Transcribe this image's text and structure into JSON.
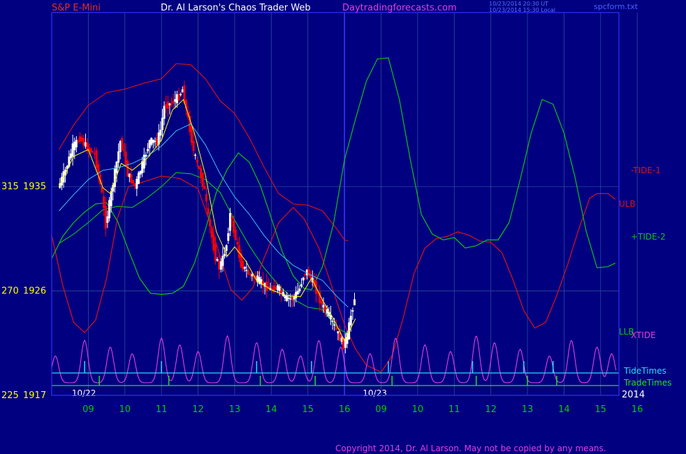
{
  "header": {
    "instrument": "S&P E-Mini",
    "site_title": "Dr. Al Larson's Chaos Trader Web",
    "site_url": "Daytradingforecasts.com",
    "timestamp_ut": "10/23/2014 20:30 UT",
    "timestamp_local": "10/23/2014 15:30 Local",
    "file_name": "spcform.txt"
  },
  "footer": {
    "copyright": "Copyright 2014, Dr. Al Larson. May not be copied by any means."
  },
  "colors": {
    "background": "#000080",
    "frame": "#3030ff",
    "grid": "#2b4a9a",
    "day_line": "#3a3aff",
    "hour_labels": "#00cc00",
    "price_labels": "#ffff00",
    "up_candle": "#ffffff",
    "down_candle": "#ff0000",
    "tide1": "#e01010",
    "tide2": "#10c010",
    "ulb": "#e01010",
    "llb": "#10c010",
    "xtide": "#e040e0",
    "tidetimes": "#20e0ff",
    "tradetimes": "#20e020",
    "ma_fast": "#ffff00",
    "ma_slow": "#40c0ff"
  },
  "chart_data": {
    "type": "candlestick",
    "title": "S&P E-Mini",
    "x_hour_ticks": [
      "09",
      "10",
      "11",
      "12",
      "13",
      "14",
      "15",
      "16",
      "09",
      "10",
      "11",
      "12",
      "13",
      "14",
      "15",
      "16"
    ],
    "date_labels": [
      "10/22",
      "10/23"
    ],
    "year_label": "2014",
    "y_ticks": [
      {
        "left": "315",
        "right": "1935",
        "price": 1935
      },
      {
        "left": "270",
        "right": "1926",
        "price": 1926
      },
      {
        "left": "225",
        "right": "1917",
        "price": 1917
      }
    ],
    "ylim": [
      1917,
      1950
    ],
    "series_labels": {
      "tide1": "-TIDE-1",
      "tide2": "+TIDE-2",
      "ulb": "ULB",
      "llb": "LLB",
      "xtide": "XTIDE",
      "tidetimes": "TideTimes",
      "tradetimes": "TradeTimes"
    },
    "price_path": [
      [
        8.2,
        1934.9
      ],
      [
        8.4,
        1936.4
      ],
      [
        8.6,
        1938.4
      ],
      [
        8.8,
        1939.2
      ],
      [
        9.0,
        1938.3
      ],
      [
        9.2,
        1937.8
      ],
      [
        9.4,
        1934.3
      ],
      [
        9.5,
        1931.7
      ],
      [
        9.7,
        1935.3
      ],
      [
        9.9,
        1938.9
      ],
      [
        10.0,
        1937.9
      ],
      [
        10.1,
        1936.1
      ],
      [
        10.3,
        1935.0
      ],
      [
        10.5,
        1936.9
      ],
      [
        10.7,
        1938.9
      ],
      [
        10.9,
        1938.9
      ],
      [
        11.0,
        1939.9
      ],
      [
        11.1,
        1941.9
      ],
      [
        11.3,
        1942.2
      ],
      [
        11.5,
        1942.8
      ],
      [
        11.6,
        1943.4
      ],
      [
        11.7,
        1941.6
      ],
      [
        11.8,
        1940.0
      ],
      [
        11.9,
        1938.0
      ],
      [
        12.0,
        1936.9
      ],
      [
        12.1,
        1935.9
      ],
      [
        12.2,
        1934.6
      ],
      [
        12.3,
        1932.3
      ],
      [
        12.4,
        1930.6
      ],
      [
        12.5,
        1928.9
      ],
      [
        12.6,
        1928.0
      ],
      [
        12.7,
        1928.8
      ],
      [
        12.8,
        1930.0
      ],
      [
        12.9,
        1932.6
      ],
      [
        13.0,
        1931.2
      ],
      [
        13.2,
        1928.3
      ],
      [
        13.4,
        1927.5
      ],
      [
        13.6,
        1927.1
      ],
      [
        13.8,
        1926.6
      ],
      [
        14.0,
        1926.1
      ],
      [
        14.2,
        1926.3
      ],
      [
        14.4,
        1925.4
      ],
      [
        14.6,
        1925.3
      ],
      [
        14.8,
        1926.2
      ],
      [
        14.9,
        1927.3
      ],
      [
        15.0,
        1927.7
      ],
      [
        15.2,
        1926.5
      ],
      [
        15.4,
        1924.8
      ],
      [
        15.6,
        1923.9
      ],
      [
        15.8,
        1922.6
      ],
      [
        16.0,
        1921.3
      ],
      [
        16.1,
        1922.1
      ],
      [
        16.2,
        1923.9
      ],
      [
        16.3,
        1925.4
      ]
    ],
    "ma_fast": [
      [
        8.2,
        1935.0
      ],
      [
        8.6,
        1937.6
      ],
      [
        9.0,
        1938.2
      ],
      [
        9.4,
        1934.9
      ],
      [
        9.6,
        1934.4
      ],
      [
        9.9,
        1937.0
      ],
      [
        10.2,
        1936.4
      ],
      [
        10.6,
        1937.4
      ],
      [
        11.0,
        1939.0
      ],
      [
        11.3,
        1941.6
      ],
      [
        11.6,
        1942.5
      ],
      [
        11.9,
        1939.6
      ],
      [
        12.2,
        1936.0
      ],
      [
        12.5,
        1931.1
      ],
      [
        12.8,
        1929.0
      ],
      [
        13.0,
        1929.8
      ],
      [
        13.3,
        1928.6
      ],
      [
        13.6,
        1926.9
      ],
      [
        14.0,
        1926.1
      ],
      [
        14.4,
        1925.6
      ],
      [
        14.8,
        1925.5
      ],
      [
        15.1,
        1927.1
      ],
      [
        15.4,
        1925.2
      ],
      [
        15.7,
        1923.6
      ],
      [
        16.0,
        1921.7
      ],
      [
        16.3,
        1923.6
      ]
    ],
    "ma_slow": [
      [
        8.2,
        1932.9
      ],
      [
        8.6,
        1934.3
      ],
      [
        9.0,
        1935.6
      ],
      [
        9.4,
        1936.4
      ],
      [
        9.8,
        1936.6
      ],
      [
        10.2,
        1937.0
      ],
      [
        10.6,
        1937.6
      ],
      [
        11.0,
        1938.5
      ],
      [
        11.4,
        1939.8
      ],
      [
        11.8,
        1940.4
      ],
      [
        12.2,
        1938.6
      ],
      [
        12.6,
        1936.1
      ],
      [
        13.0,
        1934.1
      ],
      [
        13.4,
        1932.6
      ],
      [
        13.8,
        1930.8
      ],
      [
        14.2,
        1929.3
      ],
      [
        14.6,
        1928.2
      ],
      [
        15.0,
        1927.5
      ],
      [
        15.4,
        1926.9
      ],
      [
        15.8,
        1925.5
      ],
      [
        16.1,
        1924.6
      ]
    ],
    "ulb": [
      [
        8.2,
        1938.2
      ],
      [
        8.6,
        1940.3
      ],
      [
        9.0,
        1942.0
      ],
      [
        9.5,
        1943.1
      ],
      [
        10.0,
        1943.4
      ],
      [
        10.5,
        1943.9
      ],
      [
        11.0,
        1944.3
      ],
      [
        11.4,
        1945.6
      ],
      [
        11.8,
        1945.5
      ],
      [
        12.2,
        1944.3
      ],
      [
        12.6,
        1942.4
      ],
      [
        13.0,
        1941.3
      ],
      [
        13.4,
        1939.2
      ],
      [
        13.8,
        1936.7
      ],
      [
        14.2,
        1934.4
      ],
      [
        14.6,
        1933.5
      ],
      [
        15.0,
        1933.4
      ],
      [
        15.4,
        1932.9
      ],
      [
        15.8,
        1931.3
      ],
      [
        16.0,
        1930.4
      ],
      [
        16.1,
        1930.3
      ]
    ],
    "llb": [
      [
        8.2,
        1930.1
      ],
      [
        8.6,
        1930.9
      ],
      [
        9.0,
        1931.9
      ],
      [
        9.4,
        1933.0
      ],
      [
        9.8,
        1933.3
      ],
      [
        10.2,
        1933.2
      ],
      [
        10.6,
        1934.0
      ],
      [
        11.0,
        1935.0
      ],
      [
        11.4,
        1936.2
      ],
      [
        11.8,
        1936.1
      ],
      [
        12.2,
        1935.6
      ],
      [
        12.6,
        1934.5
      ],
      [
        13.0,
        1932.1
      ],
      [
        13.4,
        1929.9
      ],
      [
        13.8,
        1928.0
      ],
      [
        14.2,
        1926.5
      ],
      [
        14.6,
        1925.3
      ],
      [
        15.0,
        1924.6
      ],
      [
        15.4,
        1924.4
      ],
      [
        15.8,
        1922.8
      ],
      [
        16.1,
        1922.3
      ]
    ],
    "tide1": [
      [
        8.0,
        1930.8
      ],
      [
        8.3,
        1926.5
      ],
      [
        8.6,
        1923.3
      ],
      [
        8.9,
        1922.4
      ],
      [
        9.2,
        1923.5
      ],
      [
        9.5,
        1927.1
      ],
      [
        9.8,
        1932.3
      ],
      [
        10.1,
        1935.0
      ],
      [
        10.5,
        1935.4
      ],
      [
        11.0,
        1935.9
      ],
      [
        11.5,
        1935.7
      ],
      [
        12.0,
        1934.8
      ],
      [
        12.3,
        1932.1
      ],
      [
        12.6,
        1929.0
      ],
      [
        12.9,
        1926.1
      ],
      [
        13.2,
        1925.2
      ],
      [
        13.5,
        1926.3
      ],
      [
        13.8,
        1928.8
      ],
      [
        14.2,
        1931.9
      ],
      [
        14.6,
        1933.2
      ],
      [
        14.9,
        1932.2
      ],
      [
        15.3,
        1929.7
      ],
      [
        15.6,
        1926.9
      ],
      [
        16.0,
        1923.1
      ],
      [
        16.3,
        1921.0
      ],
      [
        16.6,
        1919.6
      ],
      [
        17.0,
        1919.0
      ],
      [
        17.3,
        1920.4
      ],
      [
        17.6,
        1923.6
      ],
      [
        17.9,
        1927.5
      ],
      [
        18.2,
        1929.7
      ],
      [
        18.5,
        1930.5
      ],
      [
        18.8,
        1930.7
      ],
      [
        19.1,
        1931.1
      ],
      [
        19.4,
        1930.8
      ],
      [
        19.7,
        1930.3
      ],
      [
        20.0,
        1930.2
      ],
      [
        20.3,
        1929.3
      ],
      [
        20.6,
        1927.0
      ],
      [
        20.9,
        1924.3
      ],
      [
        21.2,
        1922.8
      ],
      [
        21.5,
        1923.3
      ],
      [
        21.8,
        1925.6
      ],
      [
        22.1,
        1928.3
      ],
      [
        22.4,
        1931.3
      ],
      [
        22.7,
        1934.0
      ],
      [
        22.9,
        1934.4
      ],
      [
        23.2,
        1934.4
      ],
      [
        23.4,
        1933.9
      ]
    ],
    "tide2": [
      [
        8.0,
        1928.8
      ],
      [
        8.3,
        1930.7
      ],
      [
        8.6,
        1931.9
      ],
      [
        8.9,
        1932.8
      ],
      [
        9.2,
        1933.5
      ],
      [
        9.5,
        1933.6
      ],
      [
        9.8,
        1932.0
      ],
      [
        10.1,
        1929.5
      ],
      [
        10.4,
        1927.1
      ],
      [
        10.7,
        1925.8
      ],
      [
        11.0,
        1925.7
      ],
      [
        11.3,
        1925.8
      ],
      [
        11.6,
        1926.4
      ],
      [
        11.9,
        1928.4
      ],
      [
        12.2,
        1931.3
      ],
      [
        12.5,
        1934.5
      ],
      [
        12.8,
        1936.5
      ],
      [
        13.1,
        1937.9
      ],
      [
        13.4,
        1937.1
      ],
      [
        13.7,
        1935.1
      ],
      [
        14.0,
        1932.3
      ],
      [
        14.3,
        1929.4
      ],
      [
        14.6,
        1927.3
      ],
      [
        14.9,
        1926.2
      ],
      [
        15.1,
        1926.1
      ],
      [
        15.4,
        1928.1
      ],
      [
        15.7,
        1931.8
      ],
      [
        16.0,
        1937.3
      ],
      [
        16.3,
        1940.8
      ],
      [
        16.6,
        1944.1
      ],
      [
        16.9,
        1946.0
      ],
      [
        17.2,
        1946.1
      ],
      [
        17.5,
        1942.5
      ],
      [
        17.8,
        1937.3
      ],
      [
        18.1,
        1932.6
      ],
      [
        18.4,
        1930.9
      ],
      [
        18.7,
        1930.4
      ],
      [
        19.0,
        1930.6
      ],
      [
        19.3,
        1929.7
      ],
      [
        19.6,
        1929.9
      ],
      [
        19.9,
        1930.4
      ],
      [
        20.2,
        1930.4
      ],
      [
        20.5,
        1931.9
      ],
      [
        20.8,
        1935.6
      ],
      [
        21.1,
        1939.6
      ],
      [
        21.4,
        1942.5
      ],
      [
        21.7,
        1942.1
      ],
      [
        22.0,
        1939.6
      ],
      [
        22.3,
        1935.8
      ],
      [
        22.6,
        1931.2
      ],
      [
        22.9,
        1928.0
      ],
      [
        23.2,
        1928.1
      ],
      [
        23.4,
        1928.4
      ]
    ],
    "xtide_peaks": [
      8.1,
      8.9,
      9.6,
      10.2,
      11.0,
      11.5,
      12.0,
      12.8,
      13.6,
      14.3,
      14.8,
      15.3,
      15.9,
      16.7,
      17.4,
      18.2,
      18.9,
      19.6,
      20.1,
      20.8,
      21.6,
      22.2,
      22.9,
      23.3
    ],
    "tidetimes_marks": [
      8.9,
      11.0,
      13.6,
      15.1,
      17.2,
      19.5,
      20.9,
      21.7
    ],
    "tradetimes_marks": [
      9.3,
      11.2,
      13.7,
      15.2,
      17.3,
      19.6,
      21.0,
      21.8
    ]
  }
}
